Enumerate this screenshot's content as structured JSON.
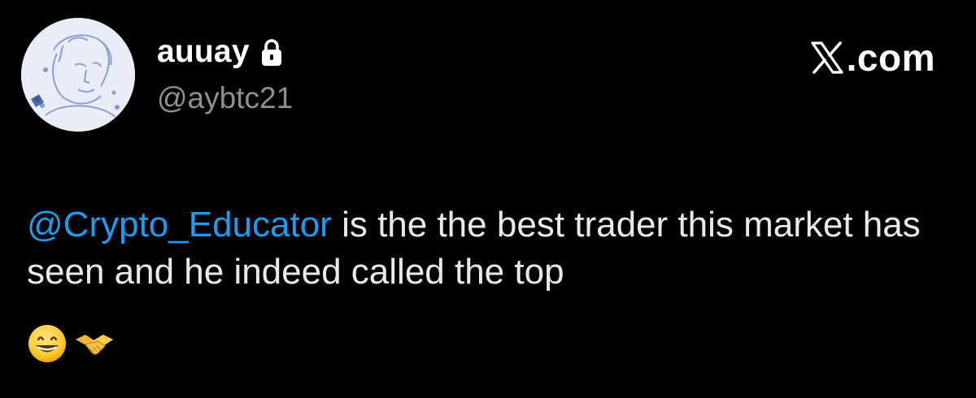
{
  "author": {
    "display_name": "auuay",
    "handle": "@aybtc21",
    "protected_icon": "lock-icon",
    "avatar": "sketch-portrait-avatar"
  },
  "brand": {
    "logo_icon": "x-logo-icon",
    "text": ".com"
  },
  "tweet": {
    "mention": "@Crypto_Educator",
    "text": " is the the best trader this market has seen and he indeed called the top",
    "emojis": [
      "grinning-face-emoji",
      "handshake-emoji"
    ]
  },
  "colors": {
    "background": "#000000",
    "text": "#e7e9ea",
    "secondary": "#8b9095",
    "mention": "#1d9bf0"
  }
}
